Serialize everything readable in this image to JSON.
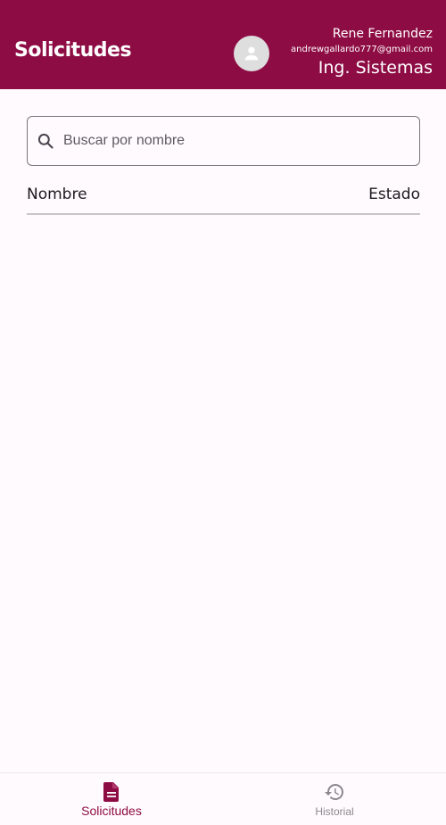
{
  "appbar": {
    "title": "Solicitudes",
    "user": {
      "name": "Rene Fernandez",
      "email": "andrewgallardo777@gmail.com",
      "department": "Ing. Sistemas"
    }
  },
  "search": {
    "placeholder": "Buscar por nombre",
    "value": ""
  },
  "table": {
    "columns": [
      "Nombre",
      "Estado"
    ],
    "rows": []
  },
  "bottom_nav": {
    "items": [
      {
        "label": "Solicitudes",
        "icon": "document-icon",
        "active": true
      },
      {
        "label": "Historial",
        "icon": "history-icon",
        "active": false
      }
    ]
  },
  "colors": {
    "primary": "#8e0c44",
    "background": "#fefafd",
    "inactive": "#8c888d"
  }
}
